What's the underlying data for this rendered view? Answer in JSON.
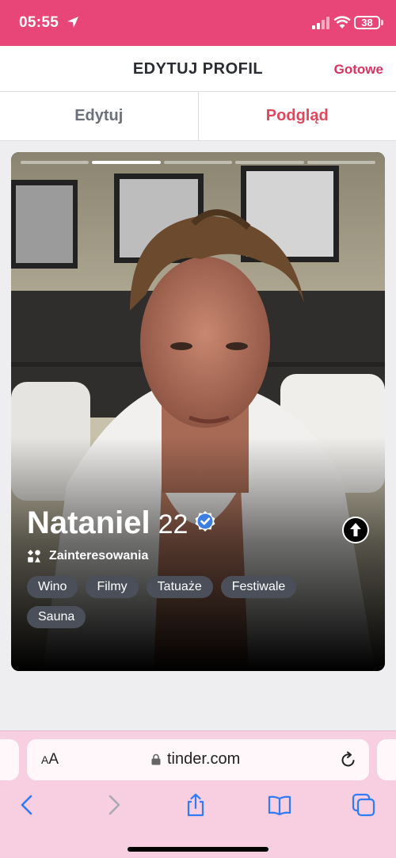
{
  "status_bar": {
    "time": "05:55",
    "battery": "38",
    "battery_level": 0.38
  },
  "header": {
    "title": "EDYTUJ PROFIL",
    "done_label": "Gotowe"
  },
  "tabs": [
    {
      "label": "Edytuj",
      "active": false
    },
    {
      "label": "Podgląd",
      "active": true
    }
  ],
  "profile": {
    "name": "Nataniel",
    "age": "22",
    "verified": true,
    "interests_title": "Zainteresowania",
    "interests": [
      "Wino",
      "Filmy",
      "Tatuaże",
      "Festiwale",
      "Sauna"
    ],
    "photo_count": 5,
    "current_photo": 2
  },
  "browser": {
    "text_size_label": "AA",
    "url": "tinder.com"
  },
  "colors": {
    "brand": "#e84679",
    "accent": "#d8325f",
    "verified": "#3d7fe0"
  },
  "icons": [
    "location-arrow-icon",
    "signal-icon",
    "wifi-icon",
    "battery-icon",
    "verified-badge-icon",
    "interests-icon",
    "arrow-up-icon",
    "lock-icon",
    "reload-icon",
    "back-icon",
    "forward-icon",
    "share-icon",
    "bookmarks-icon",
    "tabs-icon"
  ]
}
